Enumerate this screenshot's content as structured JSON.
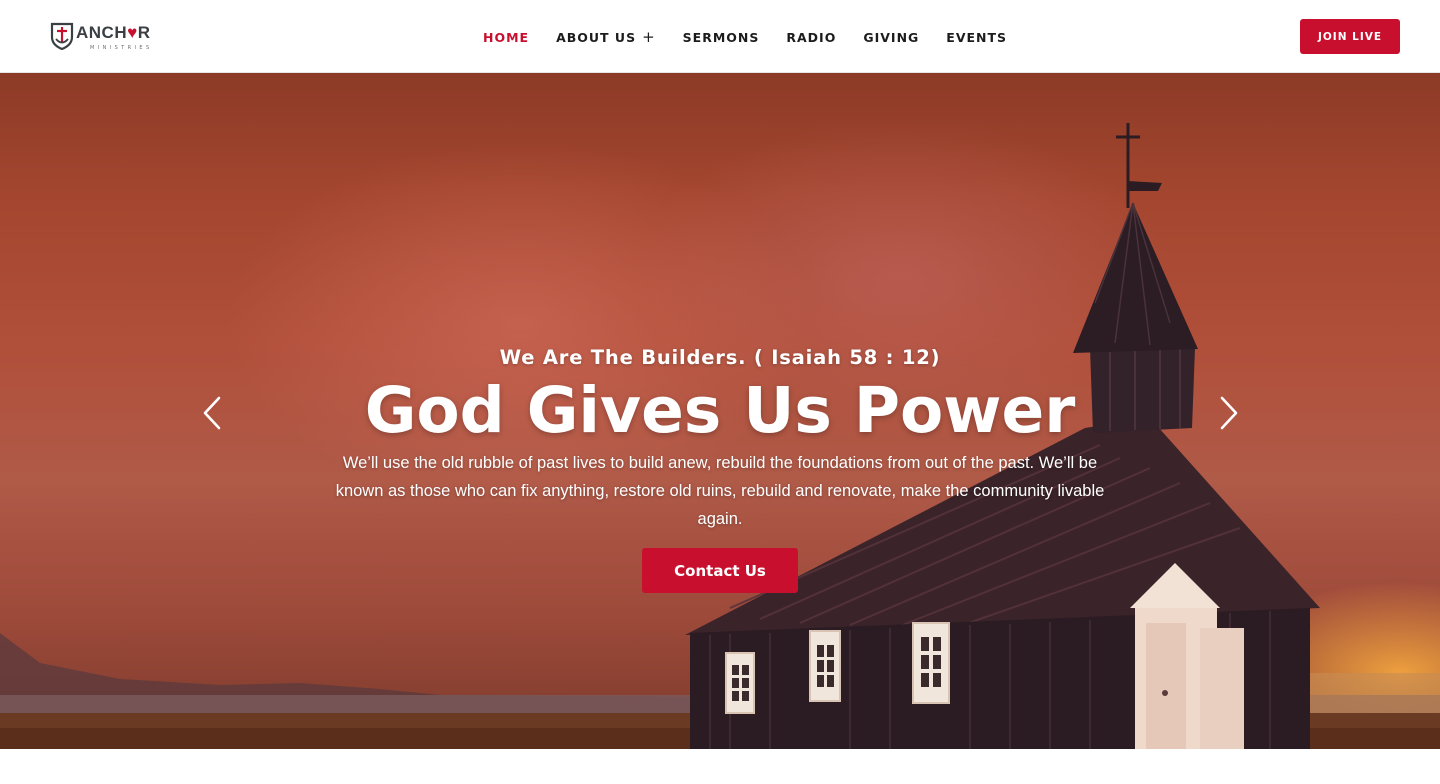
{
  "brand": {
    "logo_word_a": "ANCH",
    "logo_word_heart": "♥",
    "logo_word_b": "R",
    "logo_sub": "MINISTRIES",
    "accent_color": "#c8102e"
  },
  "nav": {
    "items": [
      {
        "label": "HOME",
        "active": true
      },
      {
        "label": "ABOUT US",
        "has_submenu": true,
        "submenu_icon": "plus-icon"
      },
      {
        "label": "SERMONS"
      },
      {
        "label": "RADIO"
      },
      {
        "label": "GIVING"
      },
      {
        "label": "EVENTS"
      }
    ],
    "submenu_glyph": "+"
  },
  "header": {
    "cta_label": "JOIN LIVE"
  },
  "hero": {
    "kicker": "We Are The Builders. ( Isaiah 58 : 12)",
    "title": "God Gives Us Power",
    "description": "We’ll use the old rubble of past lives to build anew, rebuild the foundations from out of the past. We’ll be known as those who can fix anything, restore old ruins, rebuild and renovate, make the community livable again.",
    "cta_label": "Contact Us",
    "prev_icon": "chevron-left-icon",
    "next_icon": "chevron-right-icon",
    "image": "church-at-sunset"
  }
}
